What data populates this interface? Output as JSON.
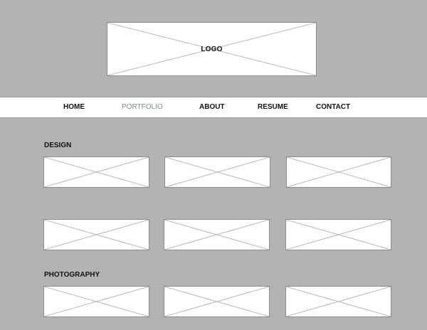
{
  "logo": {
    "label": "LOGO"
  },
  "nav": {
    "items": [
      {
        "label": "HOME",
        "active": false
      },
      {
        "label": "PORTFOLIO",
        "active": true
      },
      {
        "label": "ABOUT",
        "active": false
      },
      {
        "label": "RESUME",
        "active": false
      },
      {
        "label": "CONTACT",
        "active": false
      }
    ],
    "active_color": "#7a8c8c"
  },
  "sections": [
    {
      "heading": "DESIGN"
    },
    {
      "heading": "PHOTOGRAPHY"
    }
  ],
  "colors": {
    "background": "#b3b3b3",
    "placeholder_fill": "#ffffff",
    "placeholder_border": "#8c8c8c",
    "text": "#111111"
  }
}
